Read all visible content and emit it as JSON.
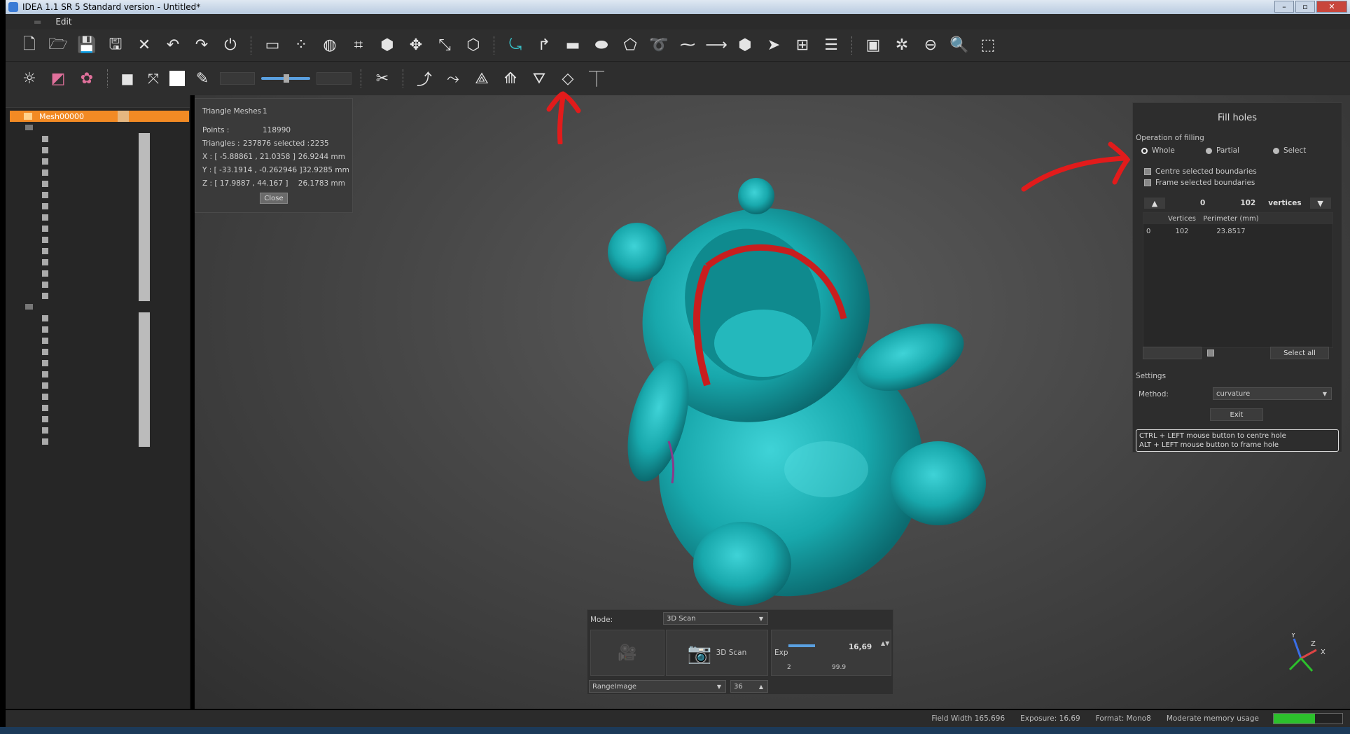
{
  "window": {
    "title": "IDEA 1.1 SR 5 Standard version - Untitled*"
  },
  "menu": {
    "items": [
      "Edit"
    ]
  },
  "tree": {
    "selected": "Mesh00000",
    "row_count_a": 15,
    "row_count_b": 12
  },
  "info": {
    "triangle_meshes_label": "Triangle Meshes :",
    "triangle_meshes_value": "1",
    "points_label": "Points :",
    "points_value": "118990",
    "triangles_label": "Triangles :",
    "triangles_value": "237876",
    "selected_label": "selected :",
    "selected_value": "2235",
    "x_range": "X : [ -5.88861 , 21.0358 ]",
    "x_size": "26.9244 mm",
    "y_range": "Y : [ -33.1914 , -0.262946 ]",
    "y_size": "32.9285 mm",
    "z_range": "Z : [ 17.9887 , 44.167 ]",
    "z_size": "26.1783 mm",
    "close_label": "Close"
  },
  "fill_holes": {
    "title": "Fill holes",
    "operation_label": "Operation of filling",
    "radio_whole": "Whole",
    "radio_partial": "Partial",
    "radio_select": "Select",
    "selected_option": "Whole",
    "chk_centre": "Centre selected boundaries",
    "chk_frame": "Frame selected boundaries",
    "counter_min": "0",
    "counter_max": "102",
    "counter_unit": "vertices",
    "table_headers": [
      "",
      "Vertices",
      "Perimeter (mm)"
    ],
    "table_rows": [
      [
        "0",
        "102",
        "23.8517"
      ]
    ],
    "select_all": "Select all",
    "settings_label": "Settings",
    "method_label": "Method:",
    "method_value": "curvature",
    "exit_label": "Exit",
    "hint_line1": "CTRL + LEFT mouse button to centre hole",
    "hint_line2": "ALT + LEFT mouse button to frame hole"
  },
  "scan": {
    "mode_label": "Mode:",
    "mode_value": "3D Scan",
    "scan_button": "3D Scan",
    "exp_label": "Exp",
    "exp_value": "16,69",
    "exp_min": "2",
    "exp_max": "99.9",
    "exp_fraction": 0.17,
    "range_label": "RangeImage",
    "range_value": "36"
  },
  "axes": {
    "x": "X",
    "y": "Y",
    "z": "Z"
  },
  "status": {
    "field_width": "Field Width 165.696",
    "exposure": "Exposure: 16.69",
    "format": "Format: Mono8",
    "memory": "Moderate memory usage",
    "memory_fraction": 0.6
  },
  "colors": {
    "mesh": "#18a8ac",
    "selection_highlight": "#c81e1e",
    "tree_selected": "#f28a24",
    "annotation": "#e21b1b",
    "memory_bar": "#2cc02c"
  }
}
